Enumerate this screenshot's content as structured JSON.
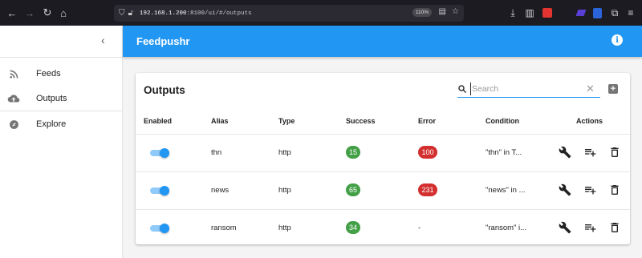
{
  "browser": {
    "url_host": "192.168.1.200",
    "url_rest": ":8100/ui/#/outputs",
    "zoom": "110%"
  },
  "sidebar": {
    "items": [
      {
        "label": "Feeds",
        "icon": "rss-icon"
      },
      {
        "label": "Outputs",
        "icon": "cloud-upload-icon"
      },
      {
        "label": "Explore",
        "icon": "compass-icon"
      }
    ]
  },
  "appbar": {
    "title": "Feedpushr"
  },
  "card": {
    "title": "Outputs",
    "search_placeholder": "Search",
    "search_value": ""
  },
  "table": {
    "headers": [
      "Enabled",
      "Alias",
      "Type",
      "Success",
      "Error",
      "Condition",
      "Actions"
    ],
    "rows": [
      {
        "enabled": true,
        "alias": "thn",
        "type": "http",
        "success": "15",
        "error": "100",
        "condition": "\"thn\" in T..."
      },
      {
        "enabled": true,
        "alias": "news",
        "type": "http",
        "success": "65",
        "error": "231",
        "condition": "\"news\" in ..."
      },
      {
        "enabled": true,
        "alias": "ransom",
        "type": "http",
        "success": "34",
        "error": "-",
        "condition": "\"ransom\" i..."
      }
    ]
  },
  "colors": {
    "primary": "#2196f3",
    "success": "#43a047",
    "error": "#d32f2f"
  }
}
